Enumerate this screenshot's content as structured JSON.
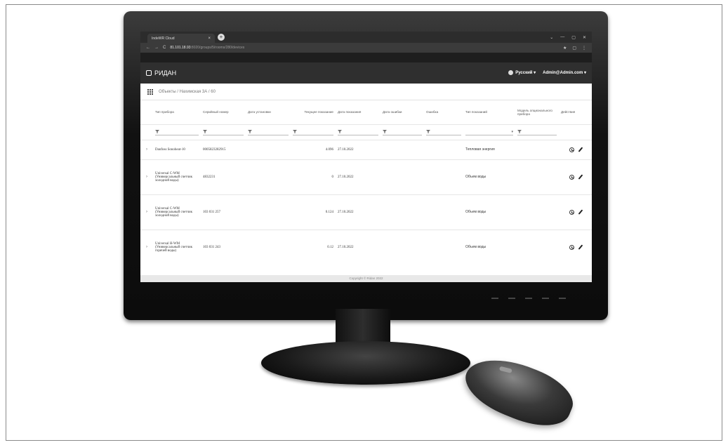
{
  "browser": {
    "tab_title": "IndeWR Cloud",
    "tab_close": "×",
    "new_tab": "+",
    "window_controls": [
      "⌄",
      "—",
      "▢",
      "✕"
    ],
    "nav": [
      "←",
      "→",
      "C"
    ],
    "url": "81.101.18.93",
    "url_dim": ":8020/groups/5/rooms/280/devices",
    "right_icons": [
      "★",
      "▢",
      "⋮"
    ]
  },
  "app": {
    "brand": "РИДАН",
    "language": "Русский ▾",
    "user": "Admin@Admin.com ▾"
  },
  "breadcrumb": "Объекты / Нахимская 3А / 60",
  "table": {
    "headers": [
      "Тип прибора",
      "Серийный номер",
      "Дата установки",
      "Текущее показание",
      "Дата показания",
      "Дата ошибки",
      "Ошибка",
      "Тип показаний",
      "Модель опционального прибора",
      "Действия"
    ],
    "filter_select_arrow": "▾",
    "rows": [
      {
        "device": "Danfoss Sonoheat-10",
        "serial": "0005823282915",
        "install": "",
        "value": "4.096",
        "read_date": "27.10.2022",
        "err_date": "",
        "error": "",
        "type": "Тепловая энергия",
        "model": ""
      },
      {
        "device": "Universal C-WM (Универсальный счетчик холодной воды)",
        "serial": "4832231",
        "install": "",
        "value": "0",
        "read_date": "27.10.2022",
        "err_date": "",
        "error": "",
        "type": "Объем воды",
        "model": ""
      },
      {
        "device": "Universal C-WM (Универсальный счетчик холодной воды)",
        "serial": "103 031 257",
        "install": "",
        "value": "0.124",
        "read_date": "27.10.2022",
        "err_date": "",
        "error": "",
        "type": "Объем воды",
        "model": ""
      },
      {
        "device": "Universal H-WM (Универсальный счетчик горячей воды)",
        "serial": "103 031 243",
        "install": "",
        "value": "0.12",
        "read_date": "27.10.2022",
        "err_date": "",
        "error": "",
        "type": "Объем воды",
        "model": ""
      }
    ]
  },
  "footer": "Copyright © Ridan 2022"
}
